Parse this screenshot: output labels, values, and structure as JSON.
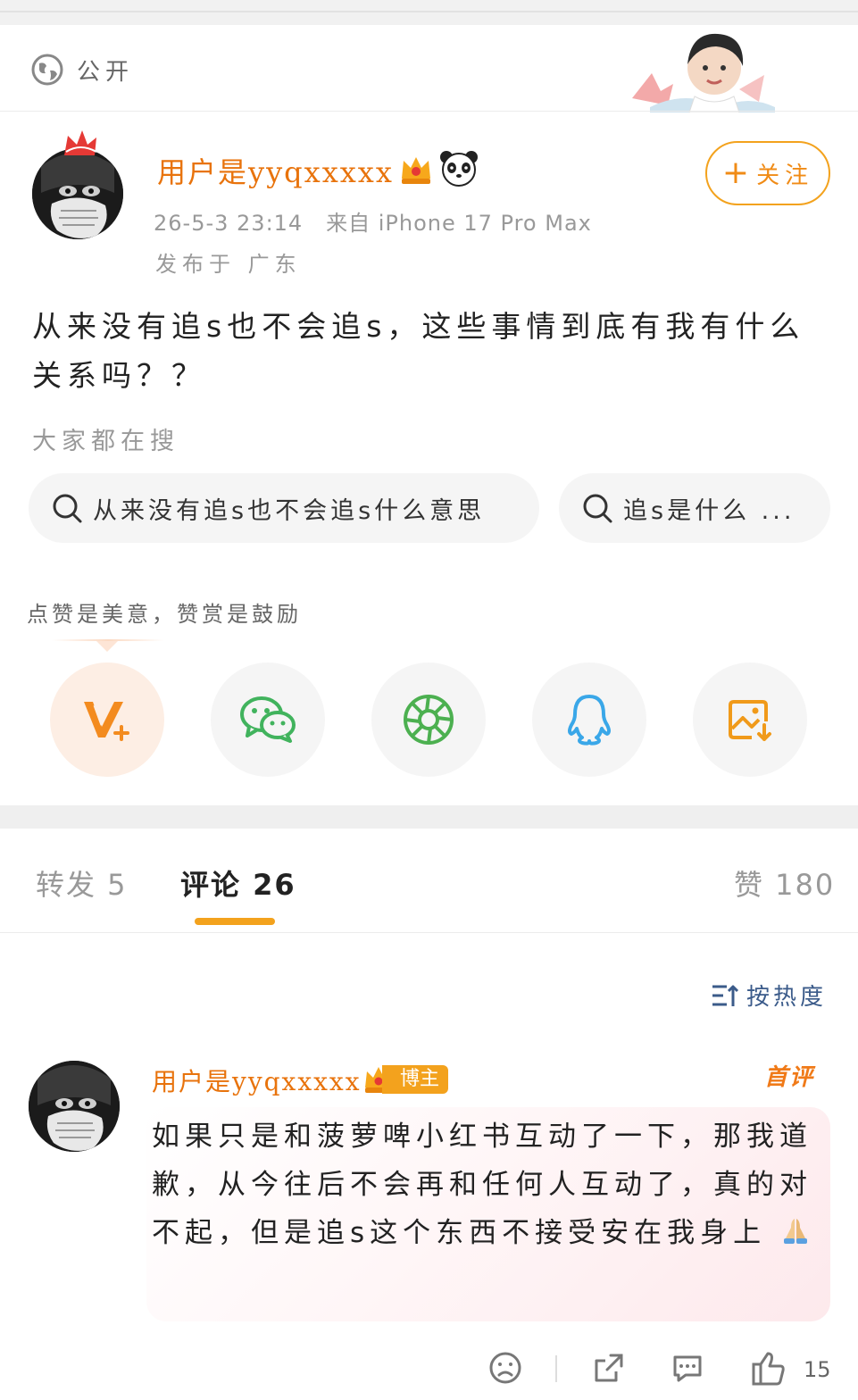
{
  "header": {
    "visibility_label": "公开"
  },
  "post": {
    "username": "用户是yyqxxxxx",
    "timestamp": "26-5-3 23:14",
    "source": "来自 iPhone 17 Pro Max",
    "location": "发布于 广东",
    "follow_label": "关注",
    "content": "从来没有追s也不会追s，这些事情到底有我有什么关系吗？？"
  },
  "search": {
    "title": "大家都在搜",
    "chips": [
      {
        "label": "从来没有追s也不会追s什么意思"
      },
      {
        "label": "追s是什么 ..."
      }
    ]
  },
  "reward_tip": "点赞是美意，赞赏是鼓励",
  "share_targets": [
    {
      "icon": "v-plus-icon"
    },
    {
      "icon": "wechat-icon"
    },
    {
      "icon": "moments-icon"
    },
    {
      "icon": "qq-icon"
    },
    {
      "icon": "save-image-icon"
    }
  ],
  "tabs": {
    "repost": "转发 5",
    "comment": "评论 26",
    "like": "赞 180"
  },
  "sort_label": "按热度",
  "comment": {
    "username": "用户是yyqxxxxx",
    "badge": "博主",
    "first_tag": "首评",
    "text": "如果只是和菠萝啤小红书互动了一下，那我道歉，从今往后不会再和任何人互动了，真的对不起，但是追s这个东西不接受安在我身上",
    "like_count": "15"
  },
  "colors": {
    "accent_orange": "#f3a21d",
    "username_orange": "#e8730c",
    "sort_blue": "#3b5b8a"
  }
}
